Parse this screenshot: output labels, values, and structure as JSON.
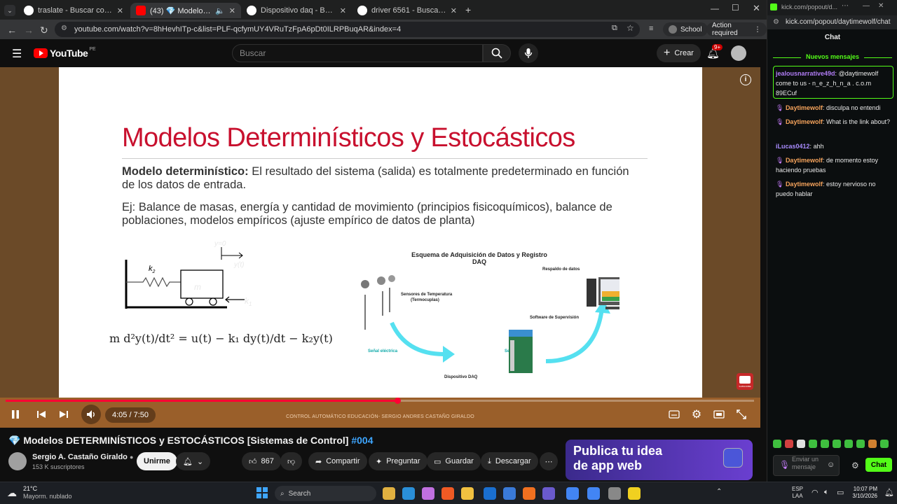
{
  "browser": {
    "tabs": [
      {
        "title": "traslate - Buscar con Google",
        "active": false
      },
      {
        "title": "(43) 💎 Modelos DETERMI",
        "active": true
      },
      {
        "title": "Dispositivo daq - Buscar con G",
        "active": false
      },
      {
        "title": "driver 6561 - Buscar con Googl",
        "active": false
      }
    ],
    "url": "youtube.com/watch?v=8hHevhITp-c&list=PLF-qcfymUY4VRuTzFpA6pDt0ILRPBuqAR&index=4",
    "profile_label": "School",
    "action_required": "Action required"
  },
  "youtube": {
    "logo_text": "YouTube",
    "region": "PE",
    "search_placeholder": "Buscar",
    "create_label": "Crear",
    "notif_count": "9+",
    "time_display": "4:05 / 7:50",
    "progress_fraction": 0.523,
    "video_title": "Modelos DETERMINÍSTICOS y ESTOCÁSTICOS [Sistemas de Control]",
    "video_hashtag": "#004",
    "title_emoji": "💎",
    "channel_name": "Sergio A. Castaño Giraldo",
    "subscribers": "153 K suscriptores",
    "subscribe_label": "Unirme",
    "likes": "867",
    "share_label": "Compartir",
    "ask_label": "Preguntar",
    "save_label": "Guardar",
    "download_label": "Descargar",
    "ad_text_1": "Publica tu idea",
    "ad_text_2": "de app web",
    "watermark": "CONTROL AUTOMÁTICO EDUCACIÓN-  SERGIO ANDRES CASTAÑO GIRALDO",
    "subscribe_badge": "SUBSCRIBE"
  },
  "slide": {
    "title": "Modelos Determinísticos y Estocásticos",
    "def_label": "Modelo determinístico:",
    "def_text": "El resultado del sistema (salida) es totalmente predeterminado en función de los datos de entrada.",
    "example_text": "Ej: Balance de masas, energía y cantidad de movimiento (principios fisicoquímicos), balance de poblaciones, modelos empíricos (ajuste empírico de datos de planta)",
    "diagram_labels": {
      "y0": "y=0",
      "yt": "y(t)",
      "k2": "k",
      "k2_sub": "2",
      "m": "m",
      "k1": "k",
      "k1_sub": "1"
    },
    "equation": "m d²y(t)/dt² = u(t) − k₁ dy(t)/dt − k₂y(t)",
    "daq_title_1": "Esquema de Adquisición de Datos y Registro",
    "daq_title_2": "DAQ",
    "daq_backup": "Respaldo de datos",
    "daq_sensors_1": "Sensores de Temperatura",
    "daq_sensors_2": "(Termocuplas)",
    "daq_software": "Software de Supervisión",
    "daq_signal_elec": "Señal eléctrica",
    "daq_signal_dig": "Señal digital",
    "daq_device": "Dispositivo DAQ"
  },
  "kick": {
    "url": "kick.com/popout/daytimewolf/chat",
    "url_short": "kick.com/popout/d...",
    "header": "Chat",
    "new_messages": "Nuevos mensajes",
    "messages": [
      {
        "user": "jealousnarrative49d",
        "text": "@daytimewolf come to us - n_e_z_h_n_a . c.o.m 89ECuf",
        "color": "#b07cf5"
      },
      {
        "user": "Daytimewolf",
        "text": "disculpa no entendi",
        "color": "#f5a35c"
      },
      {
        "user": "Daytimewolf",
        "text": "What is the link about?",
        "color": "#f5a35c"
      },
      {
        "user": "iLucas0412",
        "text": "ahh",
        "color": "#a98cff"
      },
      {
        "user": "Daytimewolf",
        "text": "de momento estoy haciendo pruebas",
        "color": "#f5a35c"
      },
      {
        "user": "Daytimewolf",
        "text": "estoy nervioso no puedo hablar",
        "color": "#f5a35c"
      }
    ],
    "input_placeholder": "Enviar un mensaje",
    "chat_button": "Chat"
  },
  "taskbar": {
    "weather_temp": "21°C",
    "weather_desc": "Mayorm. nublado",
    "search": "Search",
    "lang_1": "ESP",
    "lang_2": "LAA",
    "time": "10:07 PM",
    "date": "3/10/2026"
  },
  "colors": {
    "accent_red": "#ff0033",
    "kick_green": "#53fc18",
    "slide_title": "#c8102e"
  }
}
